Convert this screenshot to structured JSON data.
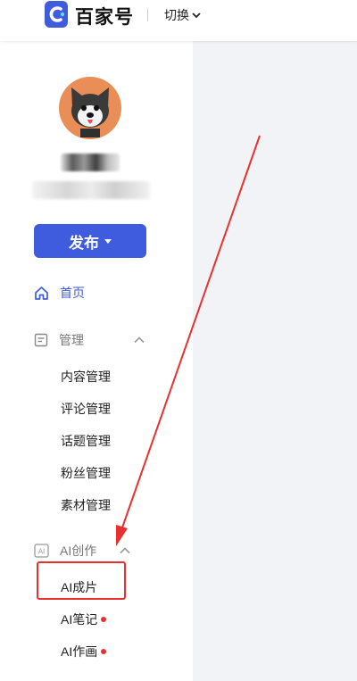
{
  "header": {
    "brand": "百家号",
    "switch_label": "切换"
  },
  "sidebar": {
    "publish_label": "发布",
    "home_label": "首页",
    "manage": {
      "label": "管理",
      "items": [
        "内容管理",
        "评论管理",
        "话题管理",
        "粉丝管理",
        "素材管理"
      ]
    },
    "ai": {
      "label": "AI创作",
      "icon_text": "AI",
      "items": [
        {
          "label": "AI成片",
          "has_dot": false
        },
        {
          "label": "AI笔记",
          "has_dot": true
        },
        {
          "label": "AI作画",
          "has_dot": true
        }
      ]
    }
  },
  "colors": {
    "accent": "#3f5bde",
    "annotation": "#e8302f",
    "content_bg": "#f2f3f7"
  }
}
